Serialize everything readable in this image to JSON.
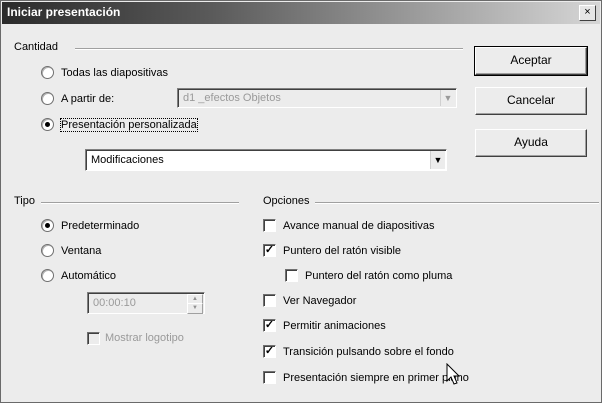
{
  "dialog": {
    "title": "Iniciar presentación",
    "close_glyph": "×"
  },
  "cantidad": {
    "label": "Cantidad",
    "radio_all": "Todas las diapositivas",
    "radio_from": "A partir de:",
    "from_value": "d1 _efectos Objetos",
    "radio_custom": "Presentación personalizada",
    "custom_value": "Modificaciones",
    "selected": "custom"
  },
  "buttons": {
    "ok": "Aceptar",
    "cancel": "Cancelar",
    "help": "Ayuda"
  },
  "tipo": {
    "label": "Tipo",
    "default": "Predeterminado",
    "window": "Ventana",
    "auto": "Automático",
    "time": "00:00:10",
    "show_logo": "Mostrar logotipo",
    "selected": "default"
  },
  "opciones": {
    "label": "Opciones",
    "items": [
      {
        "label": "Avance manual de diapositivas",
        "checked": false
      },
      {
        "label": "Puntero del ratón visible",
        "checked": true
      },
      {
        "label": "Puntero del ratón como pluma",
        "checked": false
      },
      {
        "label": "Ver Navegador",
        "checked": false
      },
      {
        "label": "Permitir animaciones",
        "checked": true
      },
      {
        "label": "Transición pulsando sobre el fondo",
        "checked": true
      },
      {
        "label": "Presentación siempre en primer plano",
        "checked": false
      }
    ]
  },
  "icons": {
    "checkmark": "✓",
    "dropdown": "▼",
    "spin_up": "▲",
    "spin_down": "▼",
    "cursor": "mouse-pointer-icon"
  }
}
